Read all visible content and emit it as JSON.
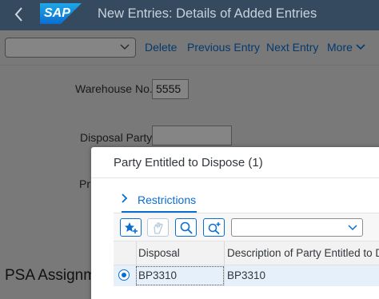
{
  "shell": {
    "back_icon": "chevron-left-icon",
    "logo_text": "SAP",
    "title": "New Entries: Details of Added Entries"
  },
  "toolbar": {
    "select_value": "",
    "delete_label": "Delete",
    "previous_label": "Previous Entry",
    "next_label": "Next Entry",
    "more_label": "More"
  },
  "form": {
    "warehouse_label": "Warehouse No.:",
    "warehouse_value": "5555",
    "disposal_label": "Disposal Party:",
    "disposal_value": "",
    "truncated_label": "Pr",
    "section_title": "PSA Assignme"
  },
  "dialog": {
    "title": "Party Entitled to Dispose (1)",
    "restrictions_label": "Restrictions",
    "toolbar_icons": [
      "add-favorite-icon",
      "hand-icon",
      "search-icon",
      "search-add-icon"
    ],
    "filter_select_value": "",
    "columns": [
      "Disposal",
      "Description of Party Entitled to Dis"
    ],
    "rows": [
      {
        "disposal": "BP3310",
        "description": "BP3310",
        "selected": true
      }
    ]
  },
  "colors": {
    "shell_bg": "#354a5f",
    "accent": "#0a6ed1",
    "selected_row": "#e5f0fa"
  }
}
